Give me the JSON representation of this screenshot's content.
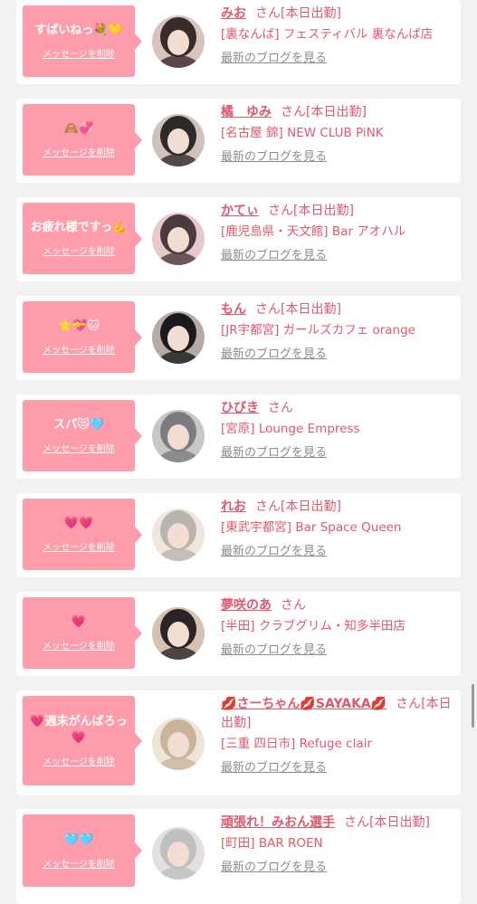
{
  "accent_color": "#fe9cab",
  "name_color": "#e0576e",
  "link_color": "#8c8c8c",
  "delete_label": "メッセージを削除",
  "san_label": "さん",
  "blog_label": "最新のブログを見る",
  "entries": [
    {
      "message": "すばいねっ💐💛",
      "name": "みお",
      "status": "[本日出勤]",
      "shop": "[裏なんば] フェスティバル 裏なんば店",
      "avatar_icon": "avatar-photo"
    },
    {
      "message": "🙈💞",
      "name": "橘　ゆみ",
      "status": "[本日出勤]",
      "shop": "[名古屋 錦] NEW CLUB PiNK",
      "avatar_icon": "avatar-photo"
    },
    {
      "message": "お疲れ様ですっ💪",
      "name": "かてぃ",
      "status": "[本日出勤]",
      "shop": "[鹿児島県・天文館] Bar アオハル",
      "avatar_icon": "avatar-photo"
    },
    {
      "message": "🌟💝🐱",
      "name": "もん",
      "status": "[本日出勤]",
      "shop": "[JR宇都宮] ガールズカフェ orange",
      "avatar_icon": "avatar-photo"
    },
    {
      "message": "スパ😻🩵",
      "name": "ひびき",
      "status": "",
      "shop": "[宮原] Lounge Empress",
      "avatar_icon": "avatar-photo"
    },
    {
      "message": "💗💗",
      "name": "れお",
      "status": "[本日出勤]",
      "shop": "[東武宇都宮] Bar Space Queen",
      "avatar_icon": "avatar-photo"
    },
    {
      "message": "💗",
      "name": "夢咲のあ",
      "status": "",
      "shop": "[半田] クラブグリム・知多半田店",
      "avatar_icon": "avatar-photo"
    },
    {
      "message": "💗週末がんばろっ💗",
      "name": "💋さーちゃん💋SAYAKA💋",
      "status": "[本日出勤]",
      "shop": "[三重 四日市] Refuge clair",
      "avatar_icon": "avatar-photo"
    },
    {
      "message": "🩵🩵",
      "name": "頑張れ！みおん選手",
      "status": "[本日出勤]",
      "shop": "[町田] BAR ROEN",
      "avatar_icon": "avatar-photo"
    }
  ]
}
